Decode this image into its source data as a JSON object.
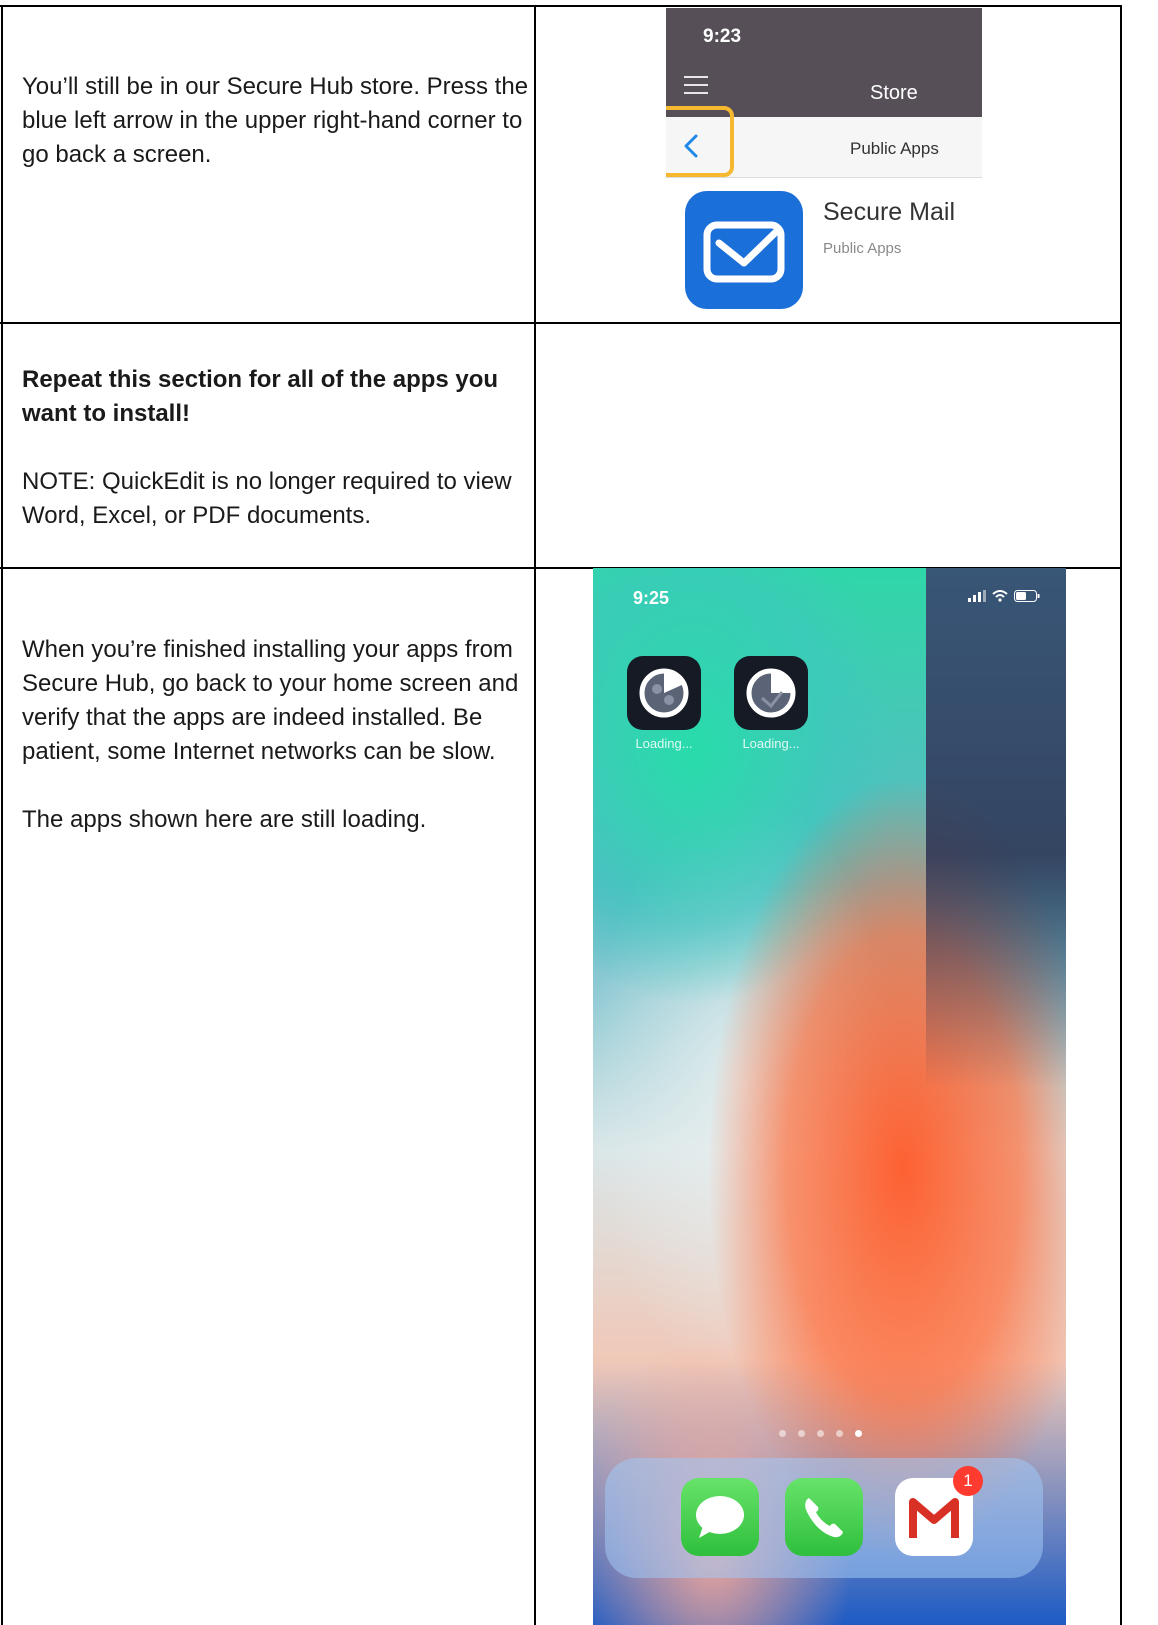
{
  "rows": [
    {
      "paragraphs": [
        {
          "text": "You’ll still be in our Secure Hub store. Press the blue left arrow in the upper right-hand corner to go back a screen.",
          "bold": false
        }
      ]
    },
    {
      "paragraphs": [
        {
          "text": "Repeat this section for all of the apps you want to install!",
          "bold": true
        },
        {
          "text": "NOTE: QuickEdit is no longer required to view Word, Excel, or PDF documents.",
          "bold": false
        }
      ]
    },
    {
      "paragraphs": [
        {
          "text": "When you’re finished installing your apps from Secure Hub, go back to your home screen and verify that the apps are indeed installed. Be patient, some Internet networks can be slow.",
          "bold": false
        },
        {
          "text": "The apps shown here are still loading.",
          "bold": false
        }
      ]
    }
  ],
  "store_screenshot": {
    "time": "9:23",
    "title": "Store",
    "subtitle": "Public Apps",
    "app_name": "Secure Mail",
    "app_category": "Public Apps",
    "header_color": "#574f58",
    "highlight_color": "#f5b82e",
    "back_arrow_color": "#1e88e5",
    "back_icon": "chevron-left-icon",
    "menu_icon": "hamburger-menu-icon"
  },
  "home_screenshot": {
    "time": "9:25",
    "apps": [
      {
        "label": "Loading..."
      },
      {
        "label": "Loading..."
      }
    ],
    "dock": [
      {
        "icon": "messages-icon"
      },
      {
        "icon": "phone-icon"
      },
      {
        "icon": "gmail-icon",
        "badge": "1"
      }
    ],
    "page_dots": 5,
    "active_dot": 5
  }
}
